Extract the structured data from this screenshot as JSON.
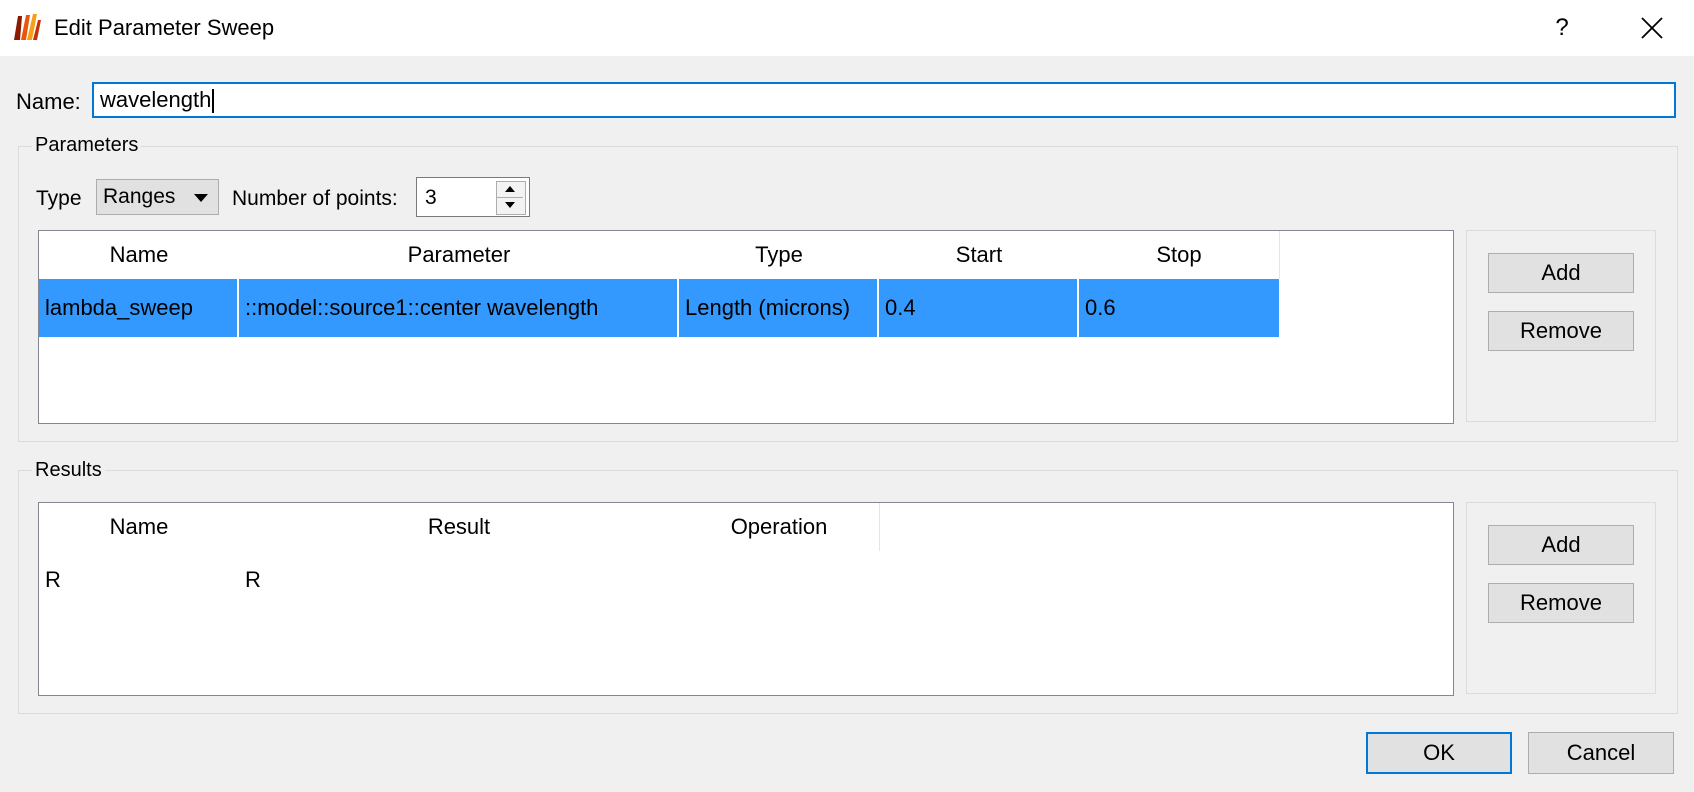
{
  "window": {
    "title": "Edit Parameter Sweep",
    "help_label": "?"
  },
  "name_field": {
    "label": "Name:",
    "value": "wavelength"
  },
  "parameters": {
    "group_label": "Parameters",
    "type_label": "Type",
    "type_value": "Ranges",
    "num_points_label": "Number of points:",
    "num_points_value": "3",
    "table": {
      "headers": [
        "Name",
        "Parameter",
        "Type",
        "Start",
        "Stop"
      ],
      "rows": [
        [
          "lambda_sweep",
          "::model::source1::center wavelength",
          "Length (microns)",
          "0.4",
          "0.6"
        ]
      ]
    },
    "add_label": "Add",
    "remove_label": "Remove"
  },
  "results": {
    "group_label": "Results",
    "table": {
      "headers": [
        "Name",
        "Result",
        "Operation"
      ],
      "rows": [
        [
          "R",
          "R",
          ""
        ]
      ]
    },
    "add_label": "Add",
    "remove_label": "Remove"
  },
  "footer": {
    "ok_label": "OK",
    "cancel_label": "Cancel"
  },
  "colors": {
    "selection": "#3399ff",
    "focus": "#0078d7",
    "background": "#f0f0f0"
  },
  "icons": {
    "app": "app-logo-icon",
    "close": "close-icon",
    "dropdown": "chevron-down-icon"
  }
}
